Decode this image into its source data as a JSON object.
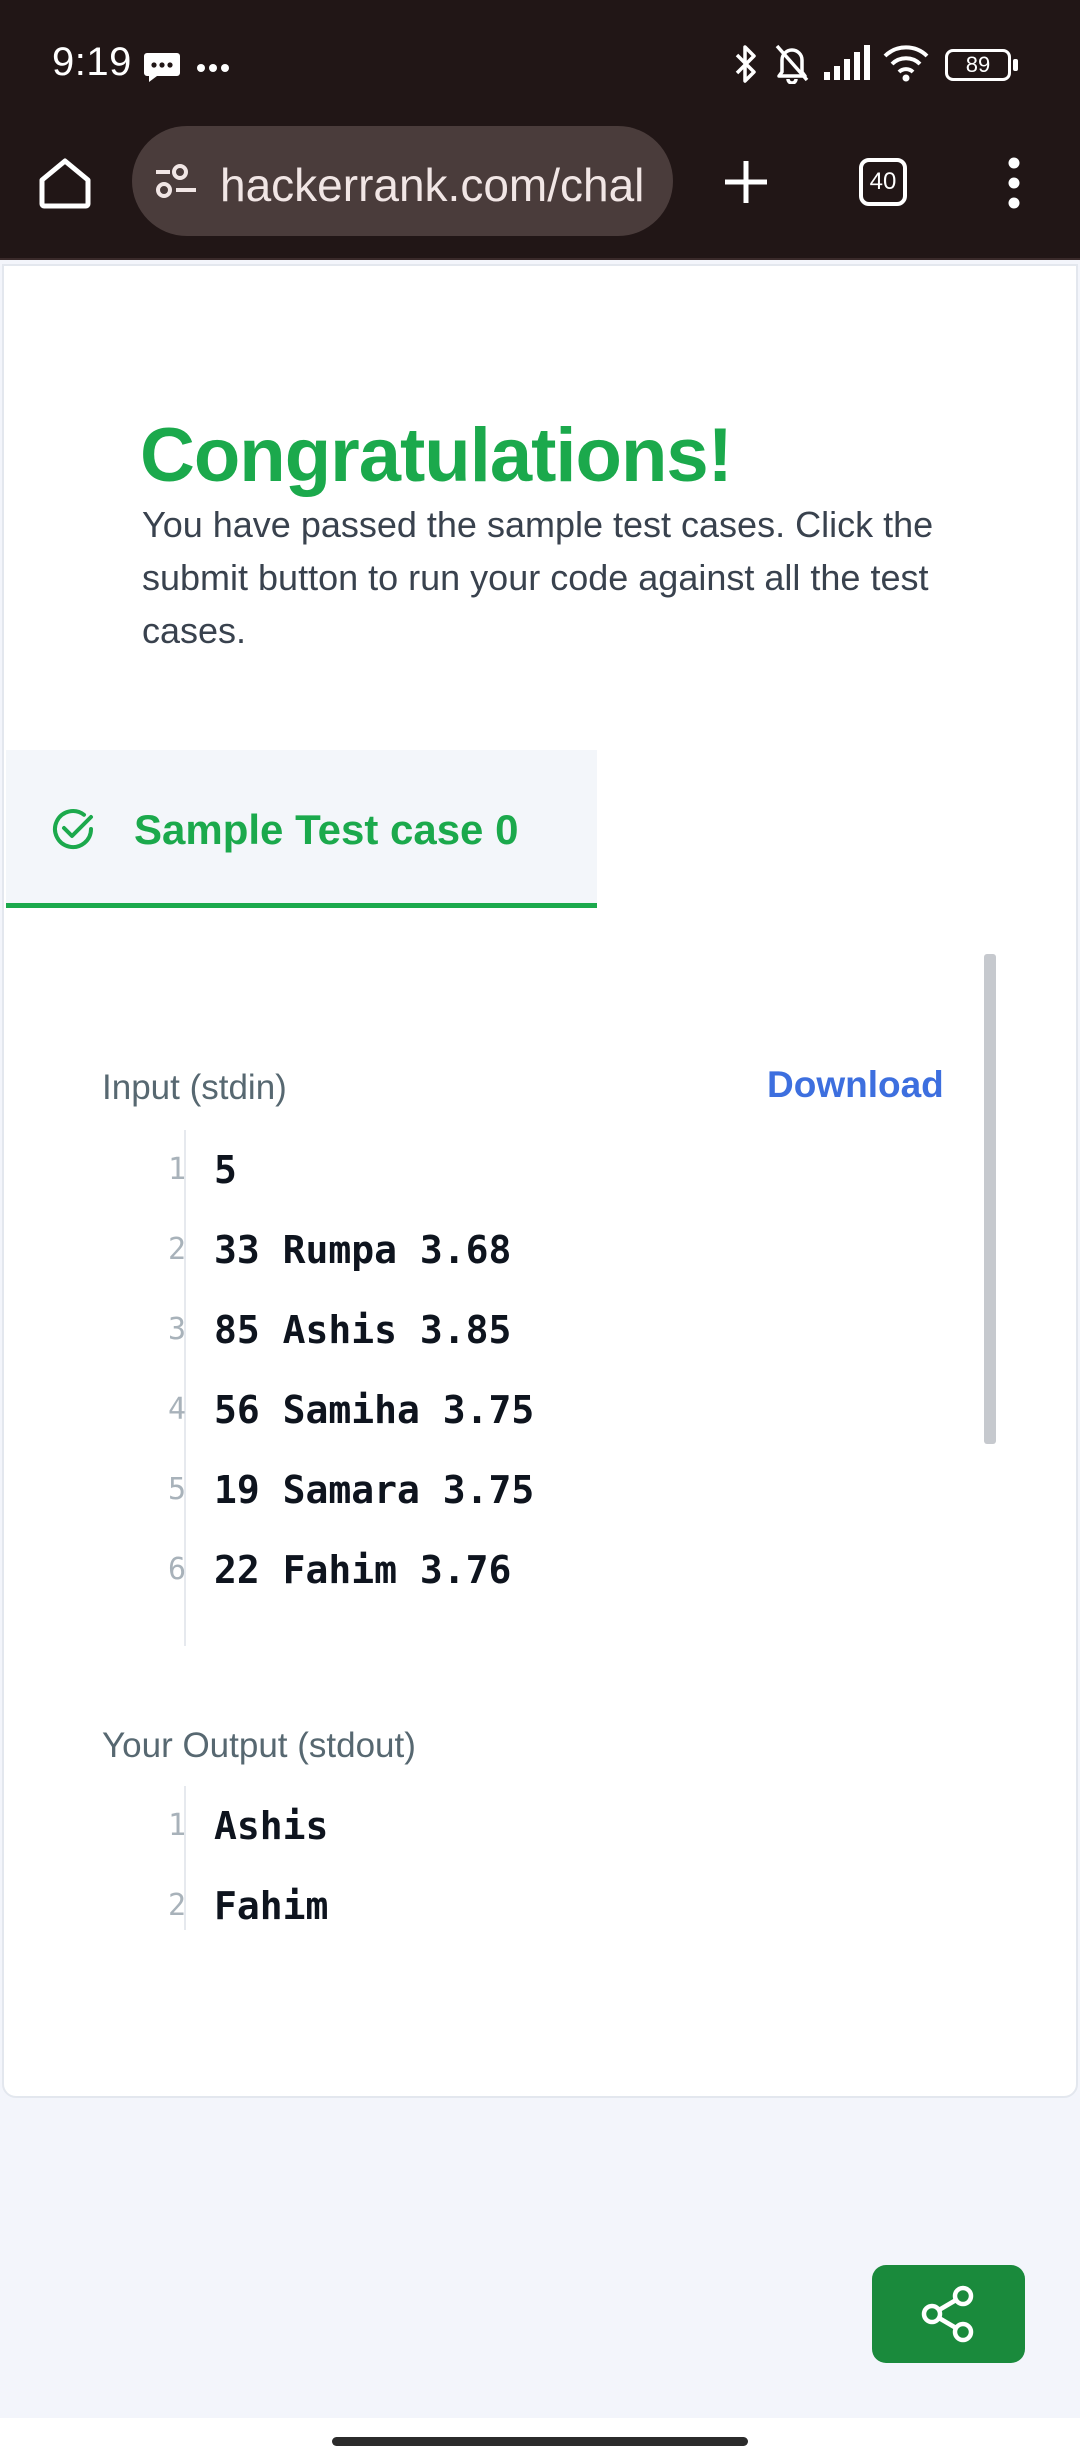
{
  "status_bar": {
    "time": "9:19",
    "battery": "89",
    "icons": [
      "message-icon",
      "more-dots-icon",
      "bluetooth-icon",
      "bell-muted-icon",
      "signal-icon",
      "wifi-icon",
      "battery-icon"
    ]
  },
  "browser": {
    "url": "hackerrank.com/chal",
    "tab_count": "40",
    "icons": [
      "home-icon",
      "site-info-icon",
      "new-tab-icon",
      "tabs-icon",
      "menu-icon"
    ]
  },
  "result": {
    "title": "Congratulations!",
    "description": "You have passed the sample test cases. Click the submit button to run your code against all the test cases."
  },
  "test_tab": {
    "label": "Sample Test case 0"
  },
  "input_section": {
    "label": "Input (stdin)",
    "download_label": "Download",
    "lines": [
      {
        "no": "1",
        "text": "5"
      },
      {
        "no": "2",
        "text": "33 Rumpa 3.68"
      },
      {
        "no": "3",
        "text": "85 Ashis 3.85"
      },
      {
        "no": "4",
        "text": "56 Samiha 3.75"
      },
      {
        "no": "5",
        "text": "19 Samara 3.75"
      },
      {
        "no": "6",
        "text": "22 Fahim 3.76"
      }
    ]
  },
  "output_section": {
    "label": "Your Output (stdout)",
    "lines": [
      {
        "no": "1",
        "text": "Ashis"
      },
      {
        "no": "2",
        "text": "Fahim"
      }
    ]
  },
  "colors": {
    "accent_green": "#1ba94c",
    "link_blue": "#3d6fdf",
    "browser_chrome": "#211616"
  }
}
